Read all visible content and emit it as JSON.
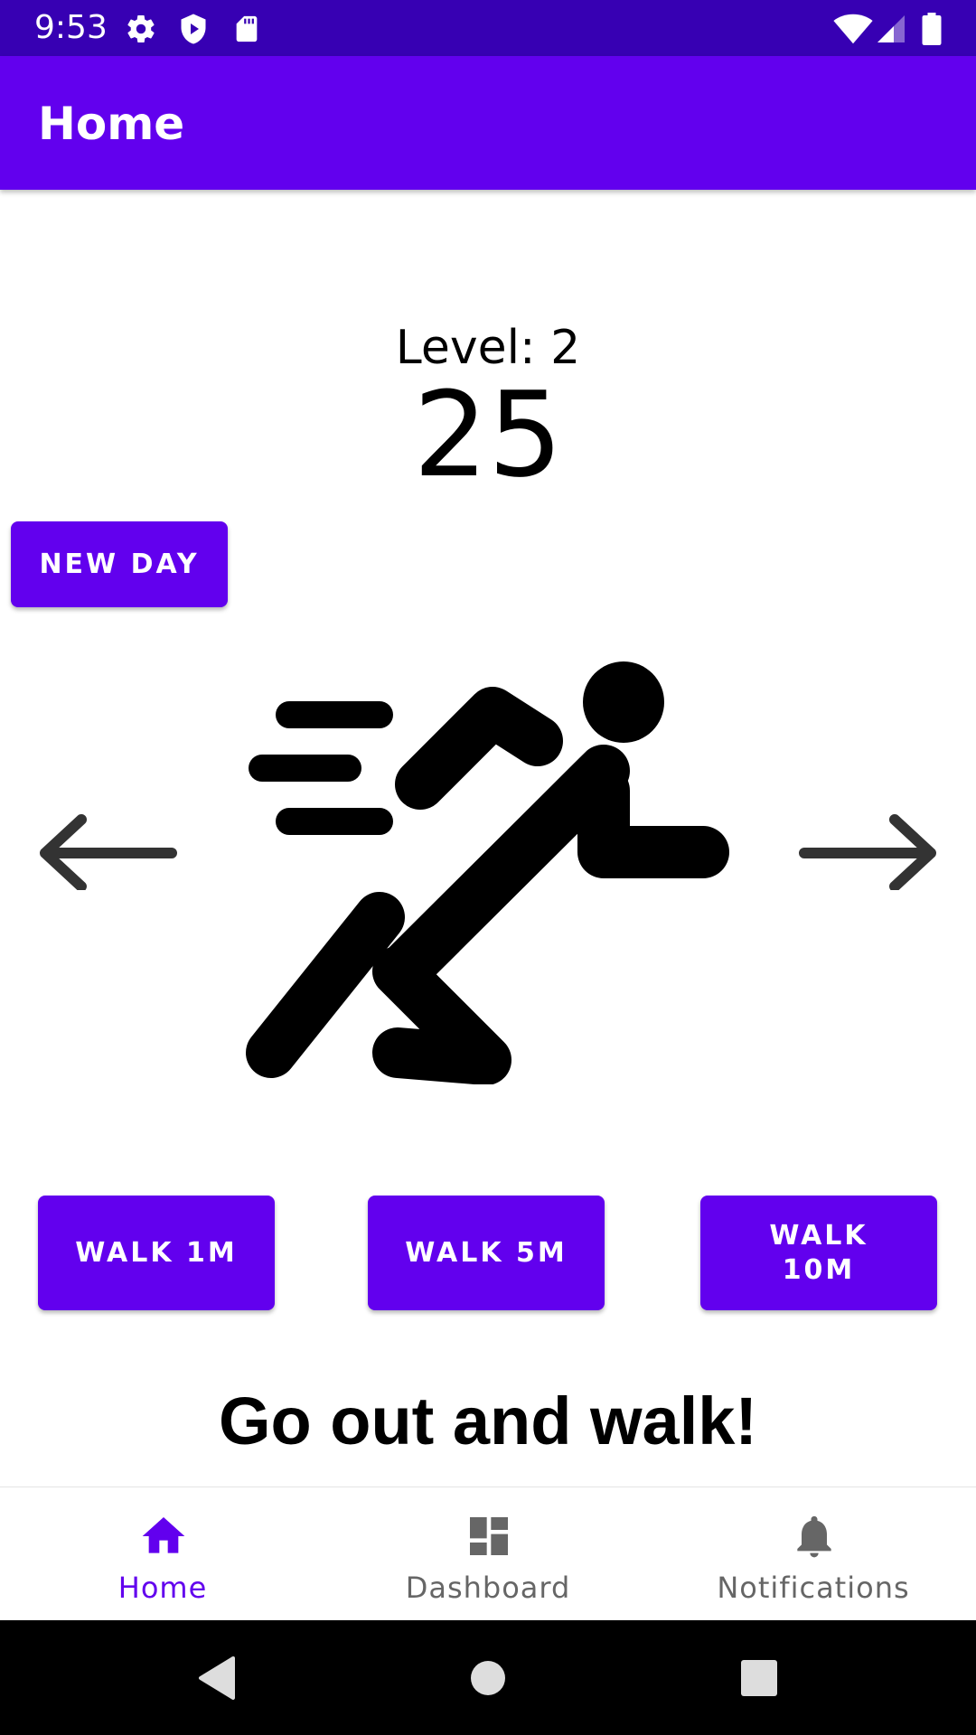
{
  "status_bar": {
    "time": "9:53",
    "icons": [
      "gear-icon",
      "shield-icon",
      "sd-card-icon",
      "wifi-icon",
      "cell-signal-icon",
      "battery-icon"
    ]
  },
  "app_bar": {
    "title": "Home"
  },
  "main": {
    "level_label": "Level: 2",
    "step_count": "25",
    "new_day_label": "NEW DAY",
    "walk_buttons": [
      "WALK 1M",
      "WALK 5M",
      "WALK 10M"
    ],
    "motivation": "Go out and walk!"
  },
  "bottom_nav": {
    "items": [
      {
        "label": "Home",
        "icon": "home-icon",
        "active": true
      },
      {
        "label": "Dashboard",
        "icon": "dashboard-icon",
        "active": false
      },
      {
        "label": "Notifications",
        "icon": "bell-icon",
        "active": false
      }
    ]
  },
  "colors": {
    "primary": "#6200ee",
    "primary_dark": "#3700b3",
    "nav_inactive": "#666666"
  }
}
